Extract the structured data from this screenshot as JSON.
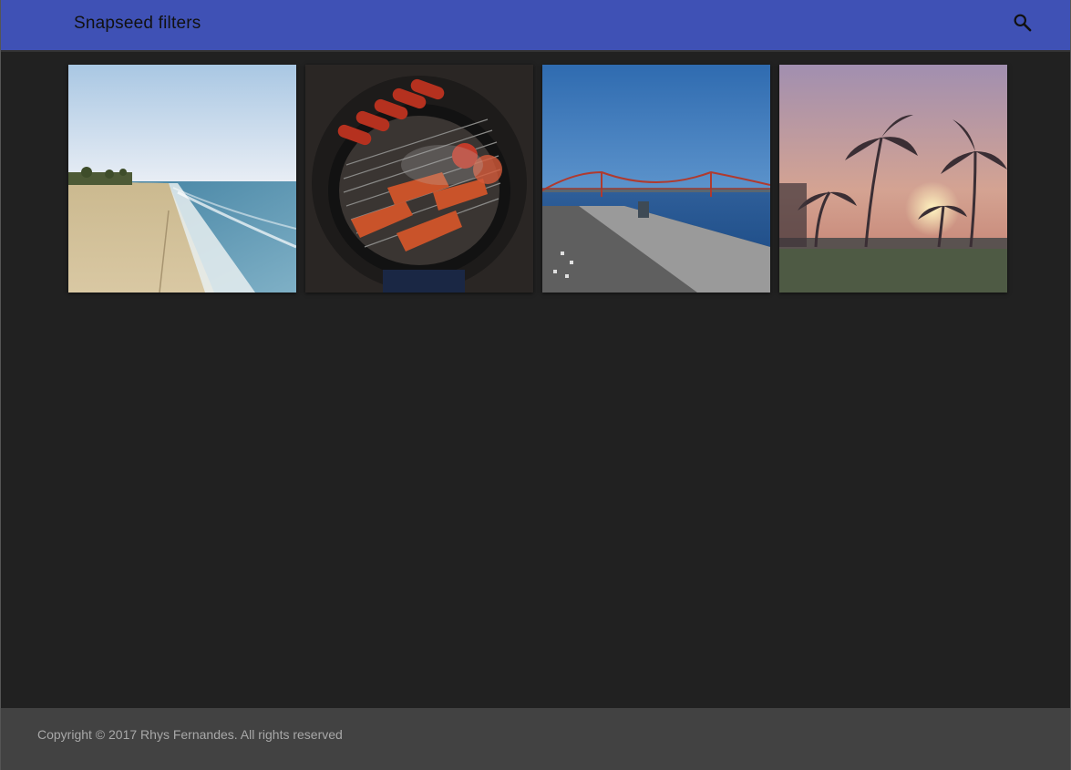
{
  "appbar": {
    "title": "Snapseed filters",
    "search_icon": "search-icon",
    "color": "#3f51b5"
  },
  "gallery": {
    "tiles": [
      {
        "subject": "beach-shoreline"
      },
      {
        "subject": "barbecue-grill"
      },
      {
        "subject": "bridge-waterfront"
      },
      {
        "subject": "palm-sunset"
      }
    ]
  },
  "footer": {
    "copyright": "Copyright © 2017 Rhys Fernandes. All rights reserved"
  }
}
